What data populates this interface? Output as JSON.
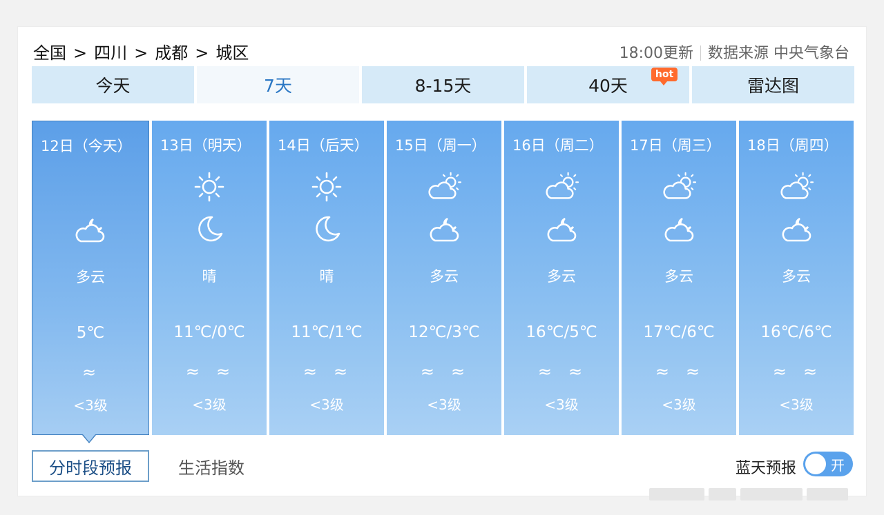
{
  "breadcrumb": [
    "全国",
    "四川",
    "成都",
    "城区"
  ],
  "breadcrumb_sep": ">",
  "update_time": "18:00更新",
  "data_source": "数据来源 中央气象台",
  "tabs": [
    {
      "label": "今天"
    },
    {
      "label": "7天",
      "active": true
    },
    {
      "label": "8-15天"
    },
    {
      "label": "40天",
      "badge": "hot"
    },
    {
      "label": "雷达图"
    }
  ],
  "days": [
    {
      "label": "12日（今天）",
      "day_icon": "",
      "night_icon": "cloudy-night-icon",
      "desc": "多云",
      "temp": "5℃",
      "wind": [
        "≈"
      ],
      "level": "<3级"
    },
    {
      "label": "13日（明天）",
      "day_icon": "sun-icon",
      "night_icon": "moon-icon",
      "desc": "晴",
      "temp": "11℃/0℃",
      "wind": [
        "≈",
        "≈"
      ],
      "level": "<3级"
    },
    {
      "label": "14日（后天）",
      "day_icon": "sun-icon",
      "night_icon": "moon-icon",
      "desc": "晴",
      "temp": "11℃/1℃",
      "wind": [
        "≈",
        "≈"
      ],
      "level": "<3级"
    },
    {
      "label": "15日（周一）",
      "day_icon": "partly-cloudy-day-icon",
      "night_icon": "cloudy-night-icon",
      "desc": "多云",
      "temp": "12℃/3℃",
      "wind": [
        "≈",
        "≈"
      ],
      "level": "<3级"
    },
    {
      "label": "16日（周二）",
      "day_icon": "partly-cloudy-day-icon",
      "night_icon": "cloudy-night-icon",
      "desc": "多云",
      "temp": "16℃/5℃",
      "wind": [
        "≈",
        "≈"
      ],
      "level": "<3级"
    },
    {
      "label": "17日（周三）",
      "day_icon": "partly-cloudy-day-icon",
      "night_icon": "cloudy-night-icon",
      "desc": "多云",
      "temp": "17℃/6℃",
      "wind": [
        "≈",
        "≈"
      ],
      "level": "<3级"
    },
    {
      "label": "18日（周四）",
      "day_icon": "partly-cloudy-day-icon",
      "night_icon": "cloudy-night-icon",
      "desc": "多云",
      "temp": "16℃/6℃",
      "wind": [
        "≈",
        "≈"
      ],
      "level": "<3级"
    }
  ],
  "subtabs": [
    {
      "label": "分时段预报",
      "active": true
    },
    {
      "label": "生活指数"
    }
  ],
  "blue_sky_label": "蓝天预报",
  "toggle_label": "开",
  "colors": {
    "accent": "#2b77c4",
    "tab_bg": "#d6eaf8",
    "card_blue": "#66a9ee",
    "hot": "#ff6a2d"
  }
}
